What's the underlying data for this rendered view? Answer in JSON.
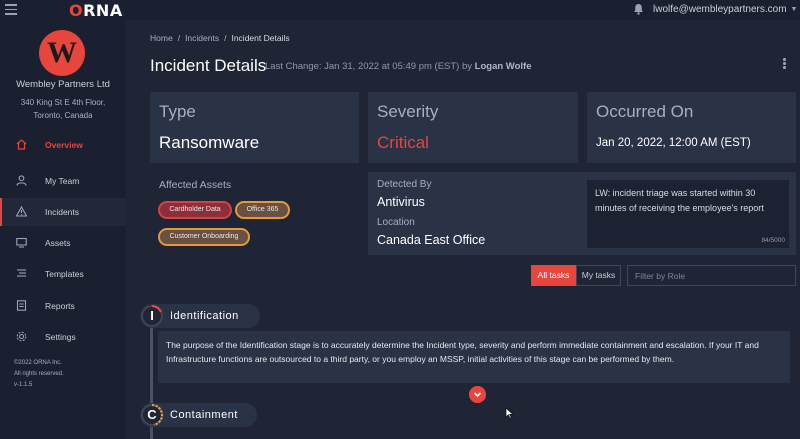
{
  "app": {
    "logo_prefix": "",
    "logo_o": "O",
    "logo_rest": "RNA"
  },
  "header": {
    "user_email": "lwolfe@wembleypartners.com"
  },
  "sidebar": {
    "org_initial": "W",
    "org_name": "Wembley Partners Ltd",
    "org_address_line1": "340 King St E 4th Floor,",
    "org_address_line2": "Toronto, Canada",
    "items": [
      {
        "label": "Overview",
        "icon": "home-icon"
      },
      {
        "label": "My Team",
        "icon": "user-icon"
      },
      {
        "label": "Incidents",
        "icon": "alert-icon"
      },
      {
        "label": "Assets",
        "icon": "monitor-icon"
      },
      {
        "label": "Templates",
        "icon": "list-icon"
      },
      {
        "label": "Reports",
        "icon": "document-icon"
      },
      {
        "label": "Settings",
        "icon": "gear-icon"
      }
    ],
    "copyright": "©2022 ORNA Inc.",
    "rights": "All rights reserved.",
    "version": "v-1.1.5"
  },
  "breadcrumb": {
    "home": "Home",
    "incidents": "Incidents",
    "current": "Incident Details"
  },
  "page": {
    "title": "Incident Details",
    "last_change_text": "Last Change: Jan 31, 2022 at 05:49 pm (EST) by",
    "last_change_user": "Logan Wolfe"
  },
  "cards": {
    "type_label": "Type",
    "type_value": "Ransomware",
    "severity_label": "Severity",
    "severity_value": "Critical",
    "occurred_label": "Occurred On",
    "occurred_value": "Jan 20, 2022, 12:00 AM (EST)"
  },
  "assets": {
    "label": "Affected Assets",
    "tags": [
      "Cardholder Data",
      "Office 365",
      "Customer Onboarding"
    ]
  },
  "detection": {
    "detected_by_label": "Detected By",
    "detected_by_value": "Antivirus",
    "location_label": "Location",
    "location_value": "Canada East Office"
  },
  "note": {
    "text": "LW: incident triage was started within 30 minutes of receiving the employee's report",
    "count": "84/5000"
  },
  "filters": {
    "all_tasks": "All tasks",
    "my_tasks": "My tasks",
    "role_placeholder": "Filter by Role"
  },
  "stages": [
    {
      "letter": "I",
      "name": "Identification",
      "description": "The purpose of the Identification stage is to accurately determine the Incident type, severity and perform immediate containment and escalation. If your IT and Infrastructure functions are outsourced to a third party, or you employ an MSSP, initial activities of this stage can be performed by them."
    },
    {
      "letter": "C",
      "name": "Containment"
    }
  ],
  "colors": {
    "accent": "#e8453c",
    "warning": "#e29a3b",
    "background": "#1f2535",
    "card": "#2a3245"
  }
}
